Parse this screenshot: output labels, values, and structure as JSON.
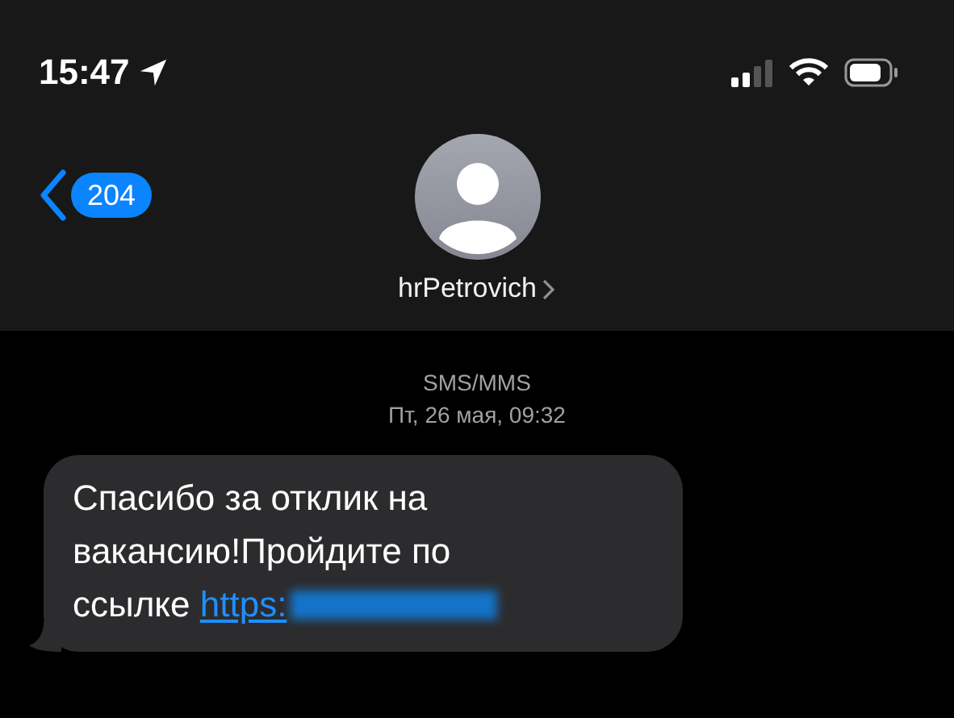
{
  "status_bar": {
    "time": "15:47"
  },
  "header": {
    "back_count": "204",
    "contact_name": "hrPetrovich"
  },
  "thread": {
    "service": "SMS/MMS",
    "date": "Пт, 26 мая, 09:32",
    "messages": [
      {
        "kind": "incoming",
        "text": "Спасибо за отклик на вакансию!Пройдите по ссылке",
        "link": "https:",
        "link_redacted": true
      }
    ]
  }
}
